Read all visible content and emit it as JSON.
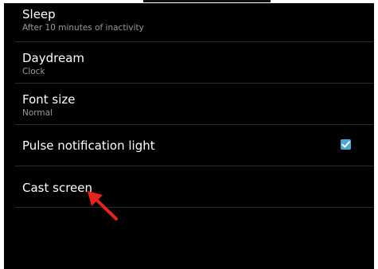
{
  "settings": {
    "items": [
      {
        "title": "Sleep",
        "subtitle": "After 10 minutes of inactivity"
      },
      {
        "title": "Daydream",
        "subtitle": "Clock"
      },
      {
        "title": "Font size",
        "subtitle": "Normal"
      },
      {
        "title": "Pulse notification light",
        "checked": true
      },
      {
        "title": "Cast screen"
      }
    ]
  },
  "colors": {
    "background": "#000000",
    "title": "#ffffff",
    "subtitle": "#9a9a9a",
    "accent": "#4aa7d4",
    "annotation_arrow": "#e8231a"
  },
  "icons": {
    "checkbox": "check-icon",
    "annotation": "red-arrow-icon"
  }
}
